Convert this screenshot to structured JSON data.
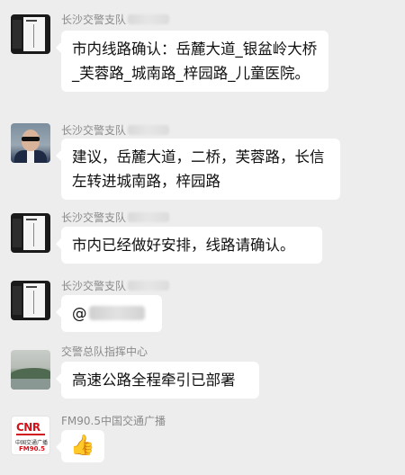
{
  "messages": [
    {
      "sender": "长沙交警支队",
      "avatar": "document-avatar",
      "text": "市内线路确认：岳麓大道_银盆岭大桥_芙蓉路_城南路_梓园路_儿童医院。"
    },
    {
      "sender": "长沙交警支队",
      "avatar": "person-sunglasses-avatar",
      "text": "建议，岳麓大道，二桥，芙蓉路，长信左转进城南路，梓园路"
    },
    {
      "sender": "长沙交警支队",
      "avatar": "document-avatar",
      "text": "市内已经做好安排，线路请确认。"
    },
    {
      "sender": "长沙交警支队",
      "avatar": "document-avatar",
      "text": "@"
    },
    {
      "sender": "交警总队指挥中心",
      "avatar": "landscape-avatar",
      "text": "高速公路全程牵引已部署"
    },
    {
      "sender": "FM90.5中国交通广播",
      "avatar": "cnr-logo-avatar",
      "text": "👍"
    }
  ],
  "cnr_logo": {
    "brand": "CNR",
    "name": "中国交通广播",
    "freq": "FM90.5"
  },
  "colors": {
    "background": "#ededed",
    "bubble": "#ffffff",
    "sender_text": "#8a8a8a",
    "message_text": "#111111"
  }
}
